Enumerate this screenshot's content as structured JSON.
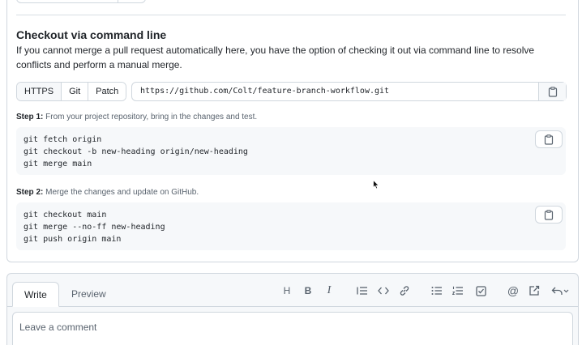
{
  "checkout": {
    "title": "Checkout via command line",
    "description": "If you cannot merge a pull request automatically here, you have the option of checking it out via command line to resolve conflicts and perform a manual merge.",
    "protocols": [
      "HTTPS",
      "Git",
      "Patch"
    ],
    "selected_protocol": "HTTPS",
    "clone_url": "https://github.com/Colt/feature-branch-workflow.git",
    "step1": {
      "label": "Step 1:",
      "text": "From your project repository, bring in the changes and test.",
      "code": [
        "git fetch origin",
        "git checkout -b new-heading origin/new-heading",
        "git merge main"
      ]
    },
    "step2": {
      "label": "Step 2:",
      "text": "Merge the changes and update on GitHub.",
      "code": [
        "git checkout main",
        "git merge --no-ff new-heading",
        "git push origin main"
      ]
    }
  },
  "editor": {
    "tabs": [
      "Write",
      "Preview"
    ],
    "active_tab": "Write",
    "toolbar": {
      "heading": "H",
      "bold": "B",
      "italic": "I",
      "mention": "@"
    },
    "placeholder": "Leave a comment"
  },
  "colors": {
    "border": "#d0d7de",
    "code_bg": "#f6f8fa",
    "muted_text": "#59636e"
  }
}
